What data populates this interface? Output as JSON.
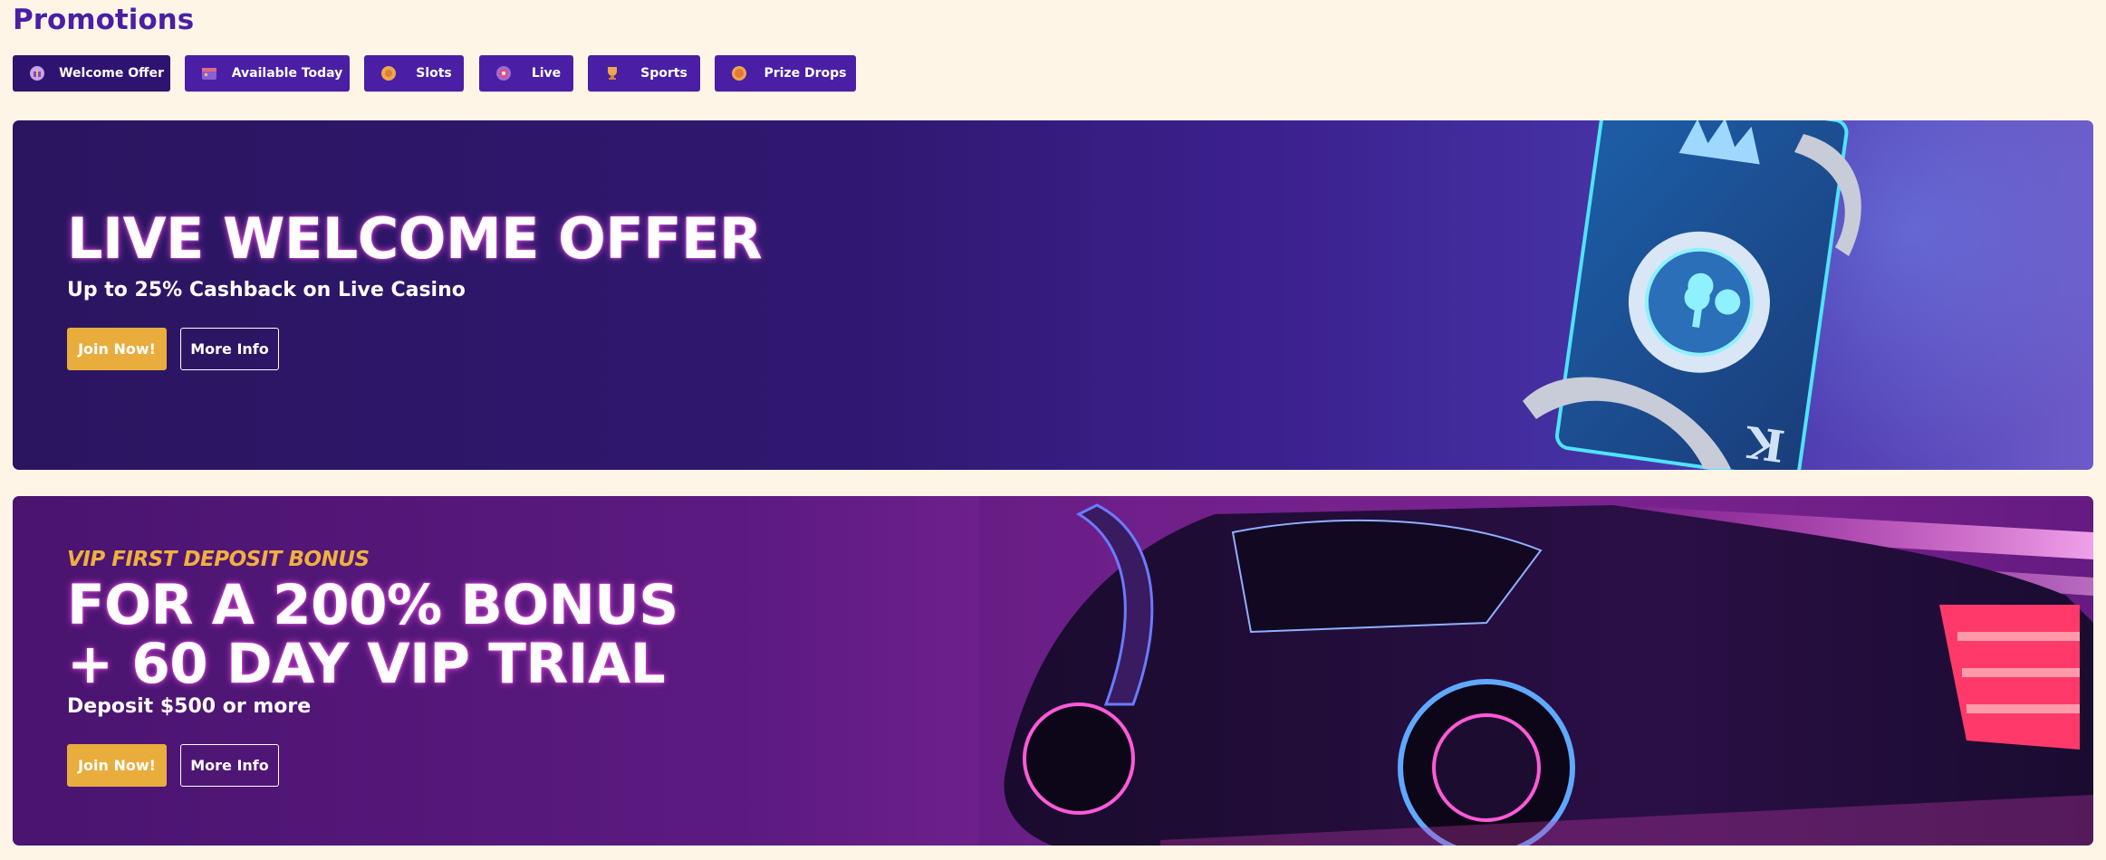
{
  "page": {
    "title": "Promotions"
  },
  "tabs": [
    {
      "label": "Welcome Offer",
      "icon": "gift-icon",
      "active": true
    },
    {
      "label": "Available Today",
      "icon": "calendar-icon",
      "active": false
    },
    {
      "label": "Slots",
      "icon": "slot-coin-icon",
      "active": false
    },
    {
      "label": "Live",
      "icon": "live-chip-icon",
      "active": false
    },
    {
      "label": "Sports",
      "icon": "trophy-icon",
      "active": false
    },
    {
      "label": "Prize Drops",
      "icon": "coin-drop-icon",
      "active": false
    }
  ],
  "banners": [
    {
      "headline": "LIVE WELCOME OFFER",
      "subline": "Up to 25% Cashback on Live Casino",
      "join_label": "Join Now!",
      "info_label": "More Info",
      "art": "king-of-clubs-card-with-casino-chip"
    },
    {
      "eyebrow": "VIP FIRST DEPOSIT BONUS",
      "headline_line1": "FOR A 200% BONUS",
      "headline_line2": "+ 60 DAY VIP TRIAL",
      "subline": "Deposit $500 or more",
      "join_label": "Join Now!",
      "info_label": "More Info",
      "art": "neon-sports-car-with-open-gullwing-door"
    }
  ],
  "colors": {
    "page_bg": "#fff5e6",
    "brand_purple": "#4a1fa6",
    "active_tab": "#2f1370",
    "accent_gold": "#e9ad3e"
  }
}
